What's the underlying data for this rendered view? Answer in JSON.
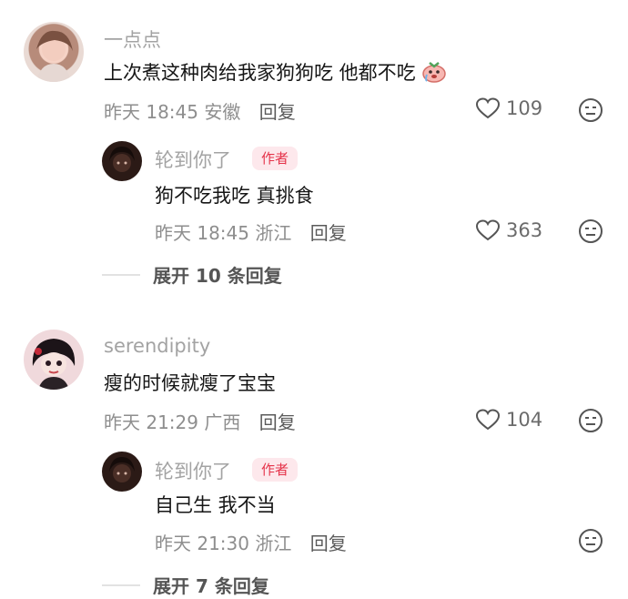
{
  "comments": [
    {
      "username": "一点点",
      "content": "上次煮这种肉给我家狗狗吃  他都不吃",
      "emoji": "crying-face",
      "time": "昨天 18:45",
      "location": "安徽",
      "reply_label": "回复",
      "likes": "109",
      "reply": {
        "username": "轮到你了",
        "badge": "作者",
        "content": "狗不吃我吃 真挑食",
        "time": "昨天 18:45",
        "location": "浙江",
        "reply_label": "回复",
        "likes": "363"
      },
      "expand_label": "展开 10 条回复"
    },
    {
      "username": "serendipity",
      "content": "瘦的时候就瘦了宝宝",
      "time": "昨天 21:29",
      "location": "广西",
      "reply_label": "回复",
      "likes": "104",
      "reply": {
        "username": "轮到你了",
        "badge": "作者",
        "content": "自己生 我不当",
        "time": "昨天 21:30",
        "location": "浙江",
        "reply_label": "回复"
      },
      "expand_label": "展开 7 条回复"
    }
  ],
  "colors": {
    "badge_bg": "#fde8ec",
    "badge_text": "#e5334a",
    "username": "#a3a3a3"
  }
}
